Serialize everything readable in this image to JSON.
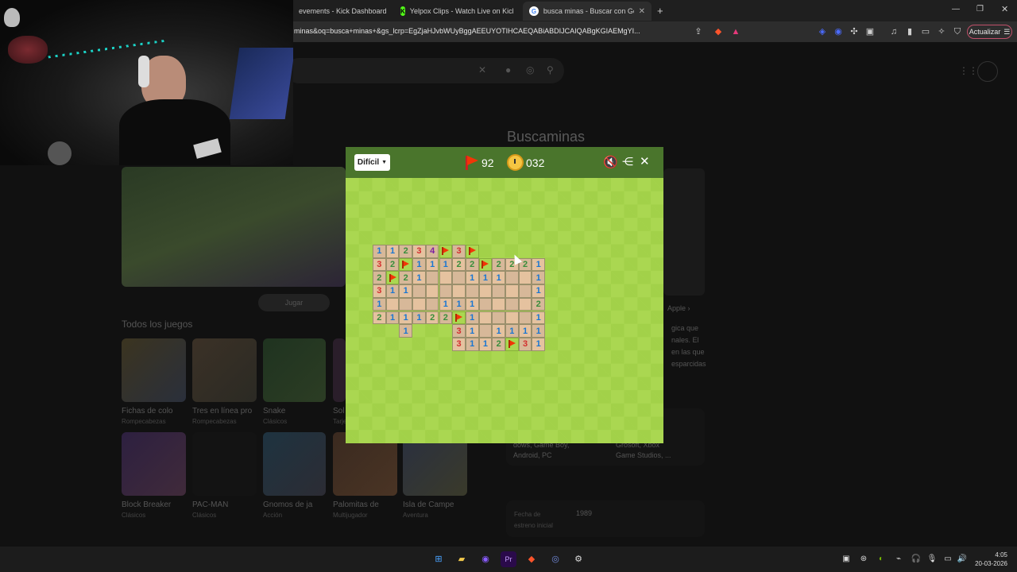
{
  "browser": {
    "tabs": [
      {
        "label": "evements - Kick Dashboard",
        "icon": "kick-icon"
      },
      {
        "label": "Yelpox Clips - Watch Live on Kick",
        "icon": "kick-icon"
      },
      {
        "label": "busca minas - Buscar con Google",
        "icon": "google-icon",
        "active": true
      }
    ],
    "new_tab": "+",
    "url": "minas&oq=busca+minas+&gs_lcrp=EgZjaHJvbWUyBggAEEUYOTIHCAEQABiABDIJCAIQABgKGIAEMgYI...",
    "update_label": "Actualizar"
  },
  "page": {
    "knowledge_title": "Buscaminas",
    "play_label": "Jugar",
    "all_games_title": "Todos los juegos",
    "games_row1": [
      {
        "name": "Fichas de colo",
        "cat": "Rompecabezas"
      },
      {
        "name": "Tres en línea pro",
        "cat": "Rompecabezas"
      },
      {
        "name": "Snake",
        "cat": "Clásicos"
      },
      {
        "name": "Sol",
        "cat": "Tarje"
      }
    ],
    "games_row2": [
      {
        "name": "Block Breaker",
        "cat": "Clásicos"
      },
      {
        "name": "PAC-MAN",
        "cat": "Clásicos"
      },
      {
        "name": "Gnomos de ja",
        "cat": "Acción"
      },
      {
        "name": "Palomitas de",
        "cat": "Multijugador"
      },
      {
        "name": "Isla de Campe",
        "cat": "Aventura"
      }
    ],
    "side_text": [
      "gica que",
      "nales. El",
      "en las que",
      "esparcidas"
    ],
    "apple_link": "Apple ›",
    "platforms_a": [
      "dows, Game Boy,",
      "Android, PC"
    ],
    "platforms_b": [
      "Grosoft, Xbox",
      "Game Studios, ..."
    ],
    "release_label": [
      "Fecha de",
      "estreno inicial"
    ],
    "release_year": "1989"
  },
  "game": {
    "difficulty": "Difícil",
    "flags_left": "92",
    "time": "032",
    "colors": {
      "header": "#4a752c",
      "grass_light": "#aad751",
      "grass_dark": "#a2d149",
      "revealed": "#e5c29f"
    },
    "number_colors": {
      "1": "#1976d2",
      "2": "#388e3c",
      "3": "#d32f2f",
      "4": "#7b1fa2"
    },
    "board": [
      "1 1 2 3 4 F 3 F . . . . .",
      "3 2 F 1 1 1 2 2 F 2 2 2 1",
      "2 F 2 1 0 0 0 1 1 1 0 0 1",
      "3 1 1 0 0 0 0 0 0 0 0 0 1",
      "1 0 0 0 0 1 1 1 0 0 0 0 2",
      "2 1 1 1 2 2 F 1 0 0 0 0 1",
      ". . 1 . . . 3 1 0 1 1 1 1",
      ". . . . . . 3 1 1 2 F 3 1"
    ]
  },
  "taskbar": {
    "time": "4:05",
    "date": "20-03-2026"
  }
}
